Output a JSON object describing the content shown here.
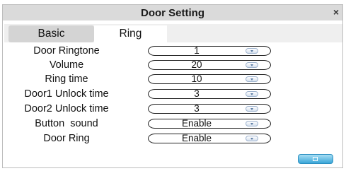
{
  "window": {
    "title": "Door Setting",
    "close_glyph": "×"
  },
  "tabs": [
    {
      "label": "Basic",
      "selected": false
    },
    {
      "label": "Ring",
      "selected": true
    }
  ],
  "settings": [
    {
      "label": "Door Ringtone",
      "value": "1"
    },
    {
      "label": "Volume",
      "value": "20"
    },
    {
      "label": "Ring time",
      "value": "10"
    },
    {
      "label": "Door1 Unlock time",
      "value": "3"
    },
    {
      "label": "Door2 Unlock time",
      "value": "3"
    },
    {
      "label": "Button  sound",
      "value": "Enable"
    },
    {
      "label": "Door Ring",
      "value": "Enable"
    }
  ],
  "footer": {
    "confirm_button_icon": "save-icon"
  },
  "colors": {
    "titlebar": "#dadada",
    "tab_strip": "#efefef",
    "confirm_button": "#3aa6d8"
  }
}
